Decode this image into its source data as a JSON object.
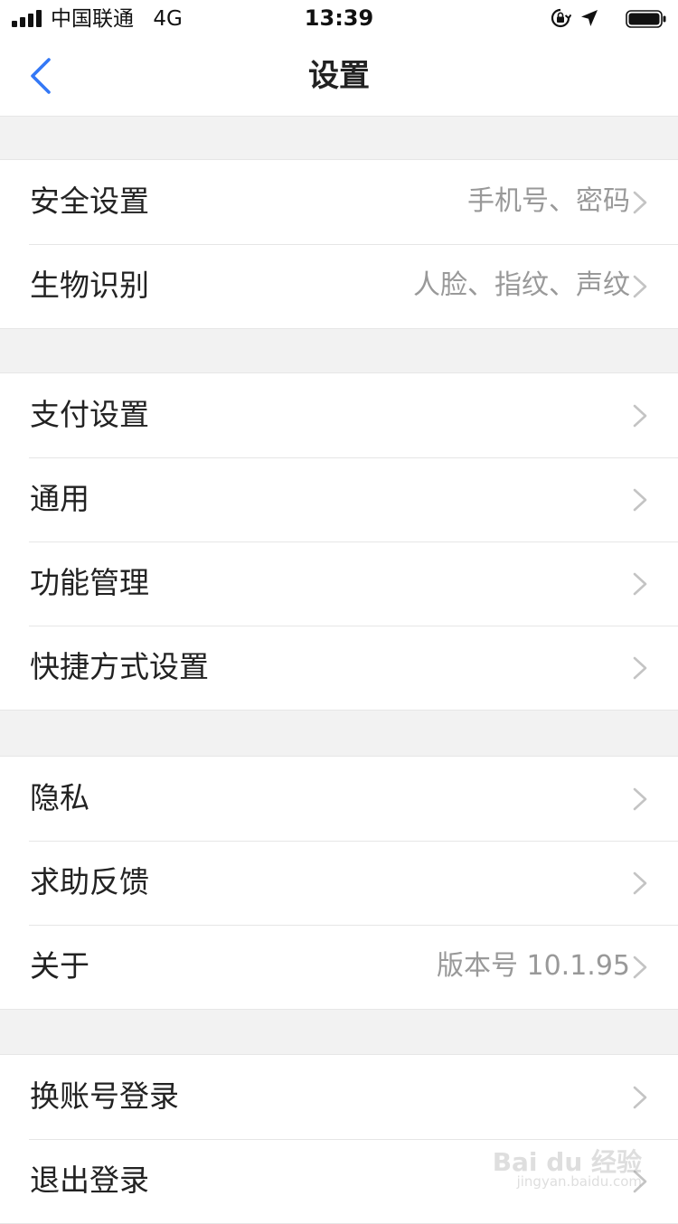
{
  "status_bar": {
    "carrier": "中国联通",
    "network": "4G",
    "time": "13:39",
    "icons": [
      "signal-icon",
      "orientation-lock-icon",
      "location-arrow-icon",
      "battery-icon"
    ]
  },
  "header": {
    "title": "设置",
    "back_icon": "chevron-left-icon",
    "accent_color": "#3478f6"
  },
  "groups": [
    {
      "items": [
        {
          "label": "安全设置",
          "value": "手机号、密码"
        },
        {
          "label": "生物识别",
          "value": "人脸、指纹、声纹"
        }
      ]
    },
    {
      "items": [
        {
          "label": "支付设置",
          "value": ""
        },
        {
          "label": "通用",
          "value": ""
        },
        {
          "label": "功能管理",
          "value": ""
        },
        {
          "label": "快捷方式设置",
          "value": ""
        }
      ]
    },
    {
      "items": [
        {
          "label": "隐私",
          "value": ""
        },
        {
          "label": "求助反馈",
          "value": ""
        },
        {
          "label": "关于",
          "value": "版本号 10.1.95"
        }
      ]
    },
    {
      "items": [
        {
          "label": "换账号登录",
          "value": ""
        },
        {
          "label": "退出登录",
          "value": ""
        }
      ]
    }
  ],
  "watermark": {
    "text": "Bai du 经验",
    "sub": "jingyan.baidu.com"
  }
}
